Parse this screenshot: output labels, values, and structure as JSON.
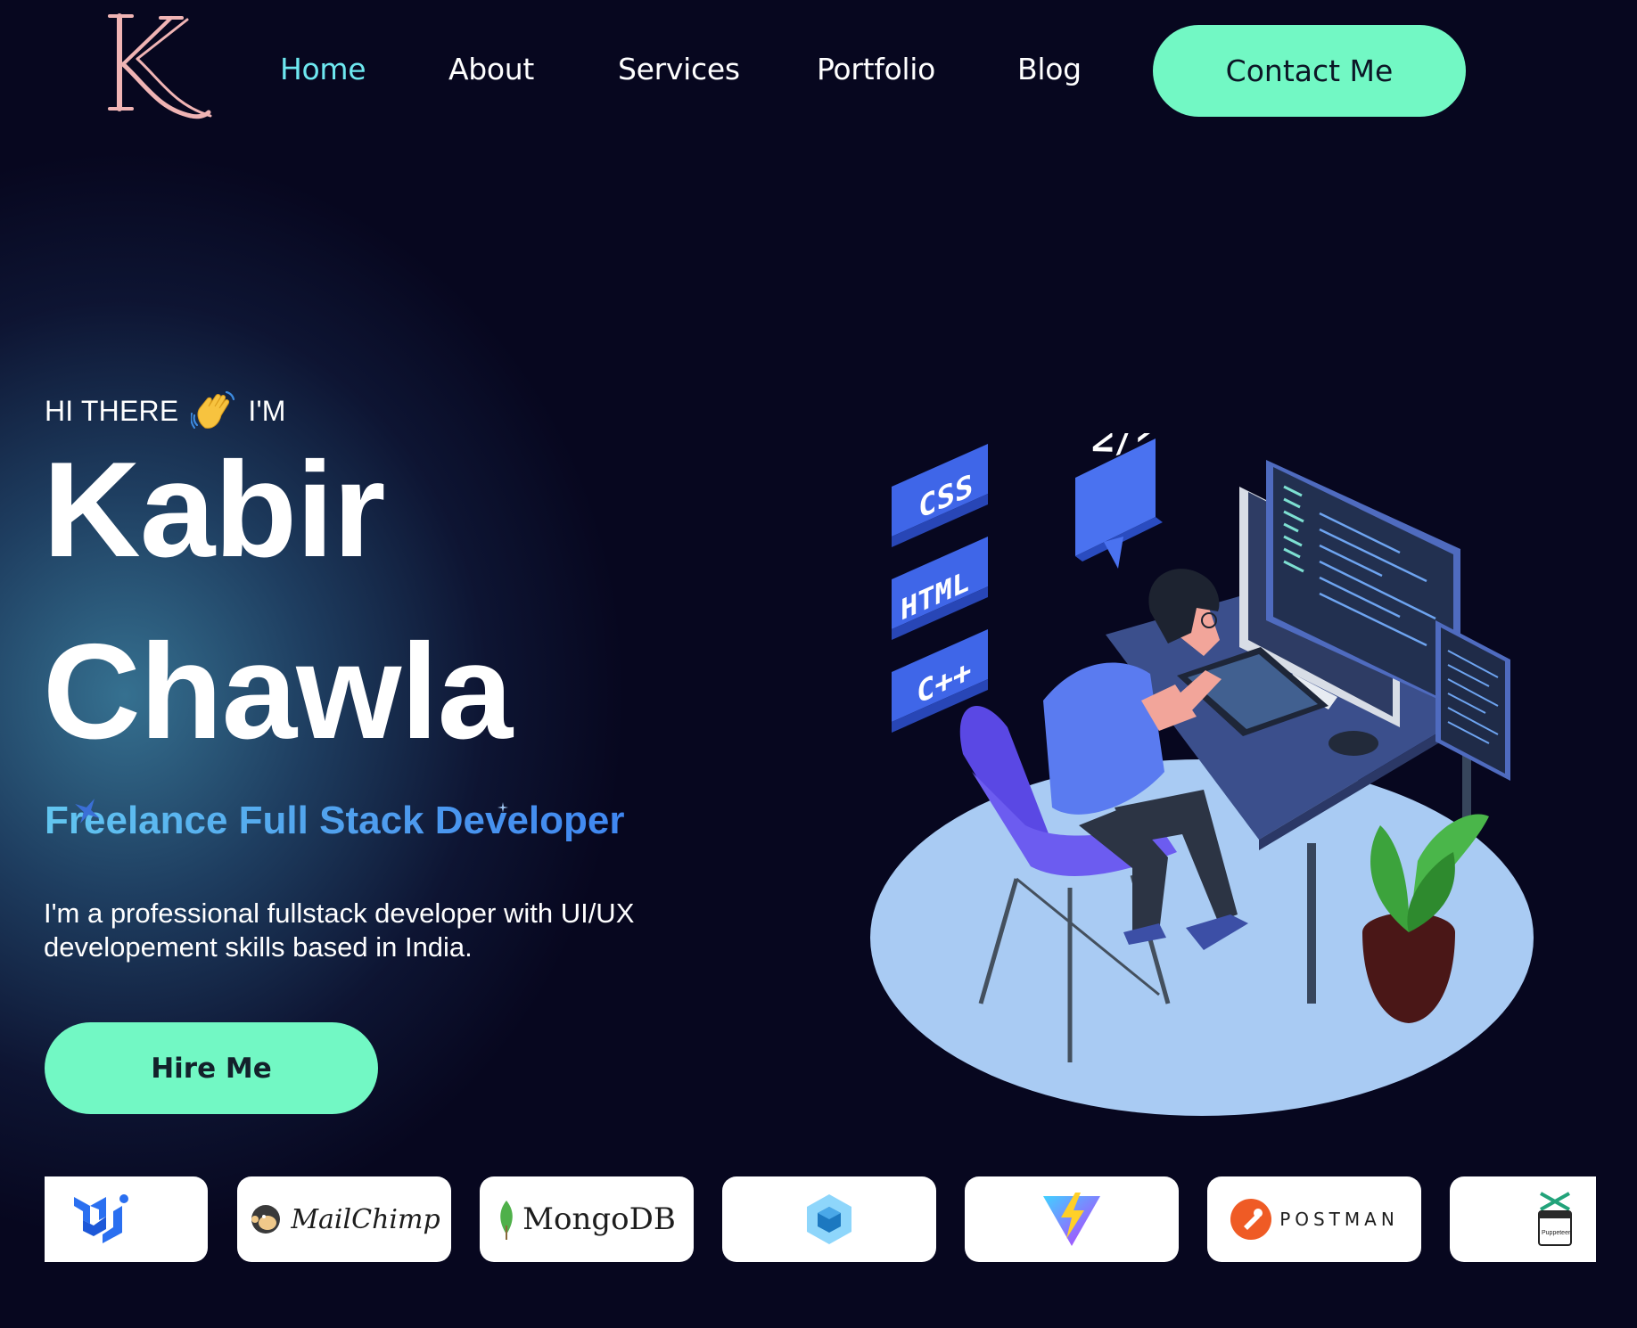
{
  "brand": {
    "logo_letter": "K",
    "color": "#f2b2b2"
  },
  "nav": {
    "links": [
      {
        "label": "Home",
        "active": true
      },
      {
        "label": "About",
        "active": false
      },
      {
        "label": "Services",
        "active": false
      },
      {
        "label": "Portfolio",
        "active": false
      },
      {
        "label": "Blog",
        "active": false
      }
    ],
    "contact_label": "Contact Me"
  },
  "hero": {
    "greeting_pre": "HI THERE",
    "greeting_post": "I'M",
    "wave_icon": "waving-hand-icon",
    "first_name": "Kabir",
    "last_name": "Chawla",
    "role": "Freelance Full Stack Developer",
    "description": "I'm a professional fullstack developer with UI/UX developement skills based in India.",
    "hire_label": "Hire Me"
  },
  "illustration": {
    "tags": [
      "CSS",
      "HTML",
      "C++"
    ],
    "code_bubble": "</>"
  },
  "tech_strip": {
    "items": [
      {
        "name": "mui-logo-icon"
      },
      {
        "name": "mailchimp-logo",
        "label": "MailChimp"
      },
      {
        "name": "mongodb-logo",
        "label": "MongoDB"
      },
      {
        "name": "webpack-logo-icon"
      },
      {
        "name": "vite-logo-icon"
      },
      {
        "name": "postman-logo",
        "label": "POSTMAN"
      },
      {
        "name": "puppeteer-logo-icon",
        "label": "Puppeteer"
      }
    ]
  },
  "colors": {
    "accent": "#72f8c4",
    "active_link": "#6ee8f0",
    "role_gradient_start": "#62c6f0",
    "role_gradient_end": "#3f86f0",
    "background": "#07071f"
  }
}
